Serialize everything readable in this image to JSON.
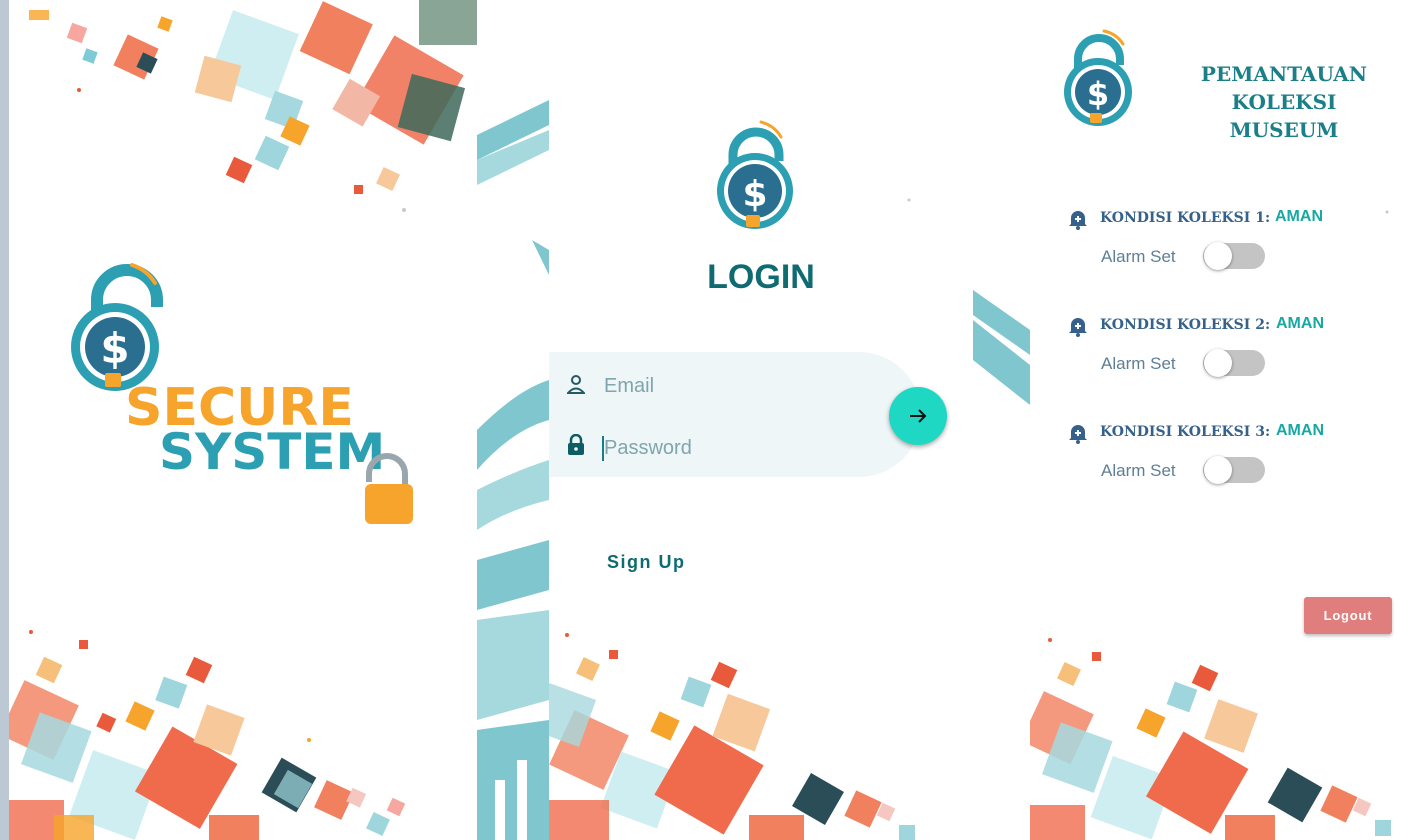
{
  "splash": {
    "brand_line1": "SECURE",
    "brand_line2": "SYSTEM"
  },
  "login": {
    "title": "LOGIN",
    "email_placeholder": "Email",
    "password_placeholder": "Password",
    "signup_label": "Sign Up",
    "submit_icon": "arrow-right-icon"
  },
  "dashboard": {
    "title_line1": "PEMANTAUAN KOLEKSI",
    "title_line2": "MUSEUM",
    "items": [
      {
        "label": "KONDISI KOLEKSI 1:",
        "status": "AMAN",
        "alarm_label": "Alarm Set",
        "alarm_on": false
      },
      {
        "label": "KONDISI KOLEKSI 2:",
        "status": "AMAN",
        "alarm_label": "Alarm Set",
        "alarm_on": false
      },
      {
        "label": "KONDISI KOLEKSI 3:",
        "status": "AMAN",
        "alarm_label": "Alarm Set",
        "alarm_on": false
      }
    ],
    "logout_label": "Logout"
  },
  "colors": {
    "teal_dark": "#0f6b72",
    "teal_accent": "#1ed8c3",
    "brand_orange": "#f6a42b",
    "brand_blue": "#2c9fb3",
    "logout_red": "#e07e7e",
    "status_green": "#17a8a3"
  }
}
